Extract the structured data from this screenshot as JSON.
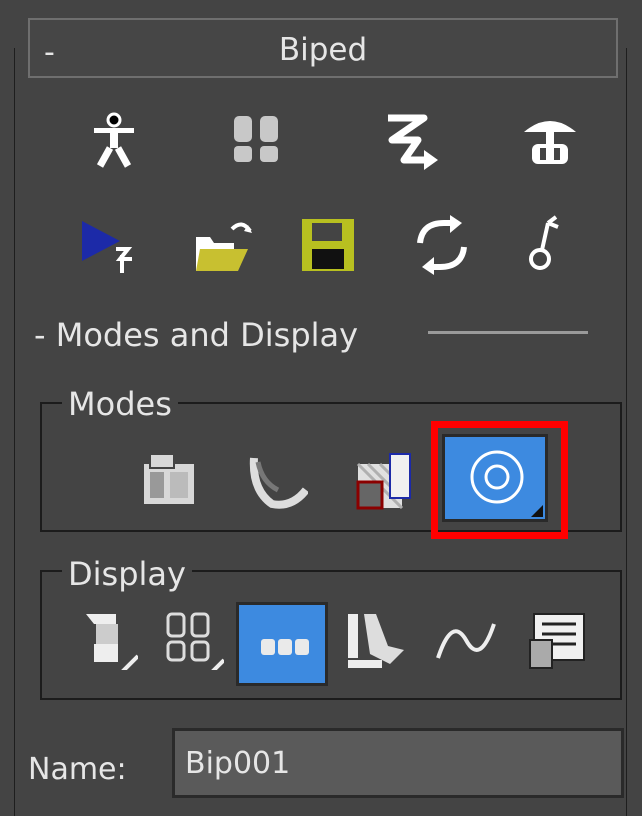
{
  "rollout": {
    "collapse_glyph": "-",
    "title": "Biped"
  },
  "toolbar_row1": [
    {
      "icon": "figure-mode-icon"
    },
    {
      "icon": "footstep-mode-icon"
    },
    {
      "icon": "motion-flow-icon"
    },
    {
      "icon": "mixer-mode-icon"
    }
  ],
  "toolbar_row2": [
    {
      "icon": "playback-icon"
    },
    {
      "icon": "open-file-icon"
    },
    {
      "icon": "save-file-icon"
    },
    {
      "icon": "convert-icon"
    },
    {
      "icon": "move-all-mode-icon"
    }
  ],
  "section": {
    "title": "- Modes and Display"
  },
  "modes": {
    "label": "Modes",
    "buttons": [
      {
        "icon": "buffer-mode-icon",
        "active": false
      },
      {
        "icon": "rubber-band-mode-icon",
        "active": false
      },
      {
        "icon": "scale-stride-icon",
        "active": false
      },
      {
        "icon": "in-place-mode-icon",
        "active": true,
        "highlighted": true
      }
    ]
  },
  "display": {
    "label": "Display",
    "buttons": [
      {
        "icon": "display-objects-icon",
        "active": false
      },
      {
        "icon": "display-footsteps-icon",
        "active": false
      },
      {
        "icon": "display-numbers-icon",
        "active": true
      },
      {
        "icon": "twist-links-icon",
        "active": false
      },
      {
        "icon": "show-trajectories-icon",
        "active": false
      },
      {
        "icon": "preferences-icon",
        "active": false
      }
    ]
  },
  "name_field": {
    "label": "Name:",
    "value": "Bip001"
  },
  "colors": {
    "panel_bg": "#444444",
    "active_blue": "#3d8ae0",
    "highlight_red": "#ff0000"
  }
}
